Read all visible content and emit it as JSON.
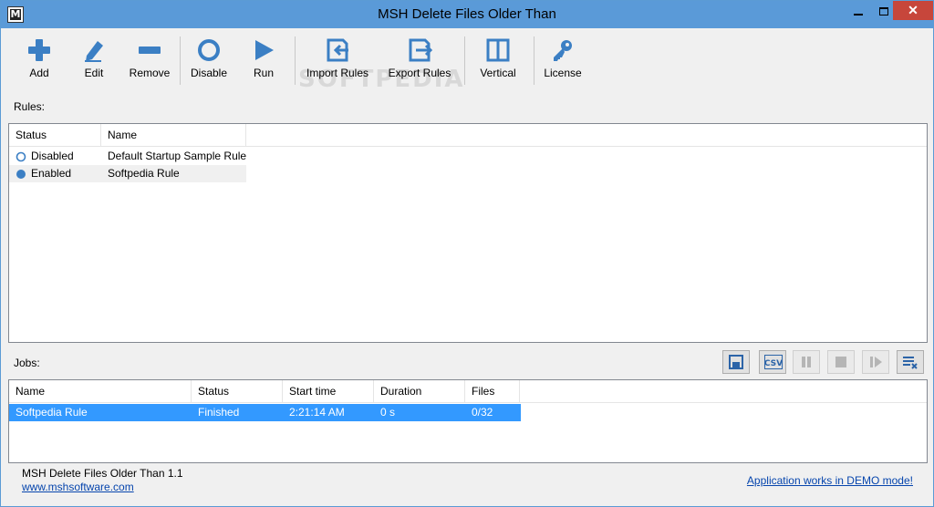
{
  "window": {
    "title": "MSH Delete Files Older Than",
    "icon_letter": "M"
  },
  "watermark": "SOFTPEDIA",
  "toolbar": {
    "add": "Add",
    "edit": "Edit",
    "remove": "Remove",
    "disable": "Disable",
    "run": "Run",
    "import_rules": "Import Rules",
    "export_rules": "Export Rules",
    "vertical": "Vertical",
    "license": "License"
  },
  "rules": {
    "label": "Rules:",
    "columns": [
      "Status",
      "Name"
    ],
    "rows": [
      {
        "status": "Disabled",
        "name": "Default Startup Sample Rule"
      },
      {
        "status": "Enabled",
        "name": "Softpedia Rule"
      }
    ]
  },
  "jobs": {
    "label": "Jobs:",
    "csv_label": "CSV",
    "columns": [
      "Name",
      "Status",
      "Start time",
      "Duration",
      "Files"
    ],
    "rows": [
      {
        "name": "Softpedia Rule",
        "status": "Finished",
        "start": "2:21:14 AM",
        "duration": "0 s",
        "files": "0/32"
      }
    ]
  },
  "footer": {
    "version": "MSH Delete Files Older Than 1.1",
    "website": "www.mshsoftware.com",
    "demo": "Application works in DEMO mode!"
  },
  "colors": {
    "accent": "#3b7fc4",
    "selection": "#3399ff",
    "titlebar": "#5a9ad8",
    "close": "#c7463b"
  }
}
